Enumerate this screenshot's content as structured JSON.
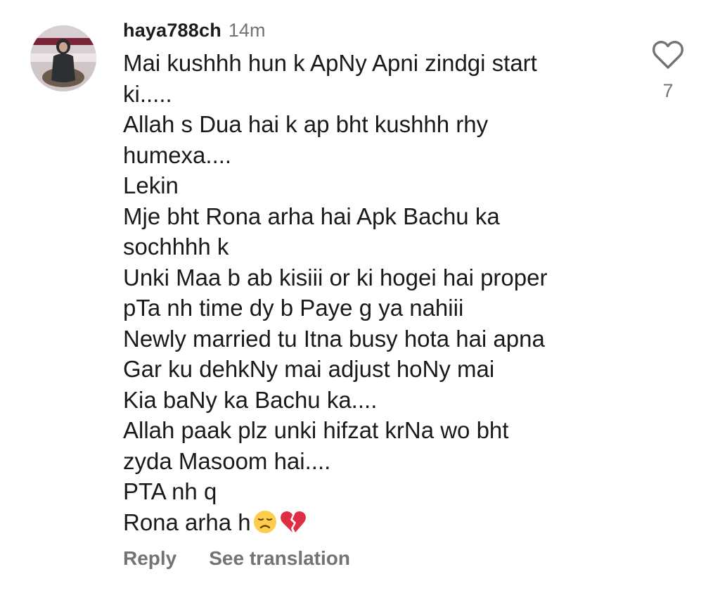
{
  "comment": {
    "username": "haya788ch",
    "timestamp": "14m",
    "lines": [
      "Mai kushhh hun k ApNy Apni zindgi start",
      "ki.....",
      "Allah s Dua hai k ap bht kushhh rhy",
      "humexa....",
      "Lekin",
      "Mje bht Rona arha hai Apk Bachu ka",
      "sochhhh k",
      "Unki Maa b ab kisiii or ki hogei hai proper",
      "pTa nh time dy b Paye g ya nahiii",
      "Newly married tu Itna busy hota hai apna",
      "Gar ku dehkNy mai adjust hoNy mai",
      "Kia baNy ka Bachu ka....",
      "Allah paak plz unki hifzat krNa wo bht",
      "zyda Masoom hai....",
      "PTA nh q",
      "Rona arha h"
    ],
    "last_line_emojis": [
      "disappointed-face-emoji",
      "broken-heart-emoji"
    ],
    "like_count": "7"
  },
  "actions": {
    "reply_label": "Reply",
    "translate_label": "See translation"
  },
  "colors": {
    "text": "#1a1a1a",
    "secondary": "#737373",
    "background": "#ffffff"
  }
}
